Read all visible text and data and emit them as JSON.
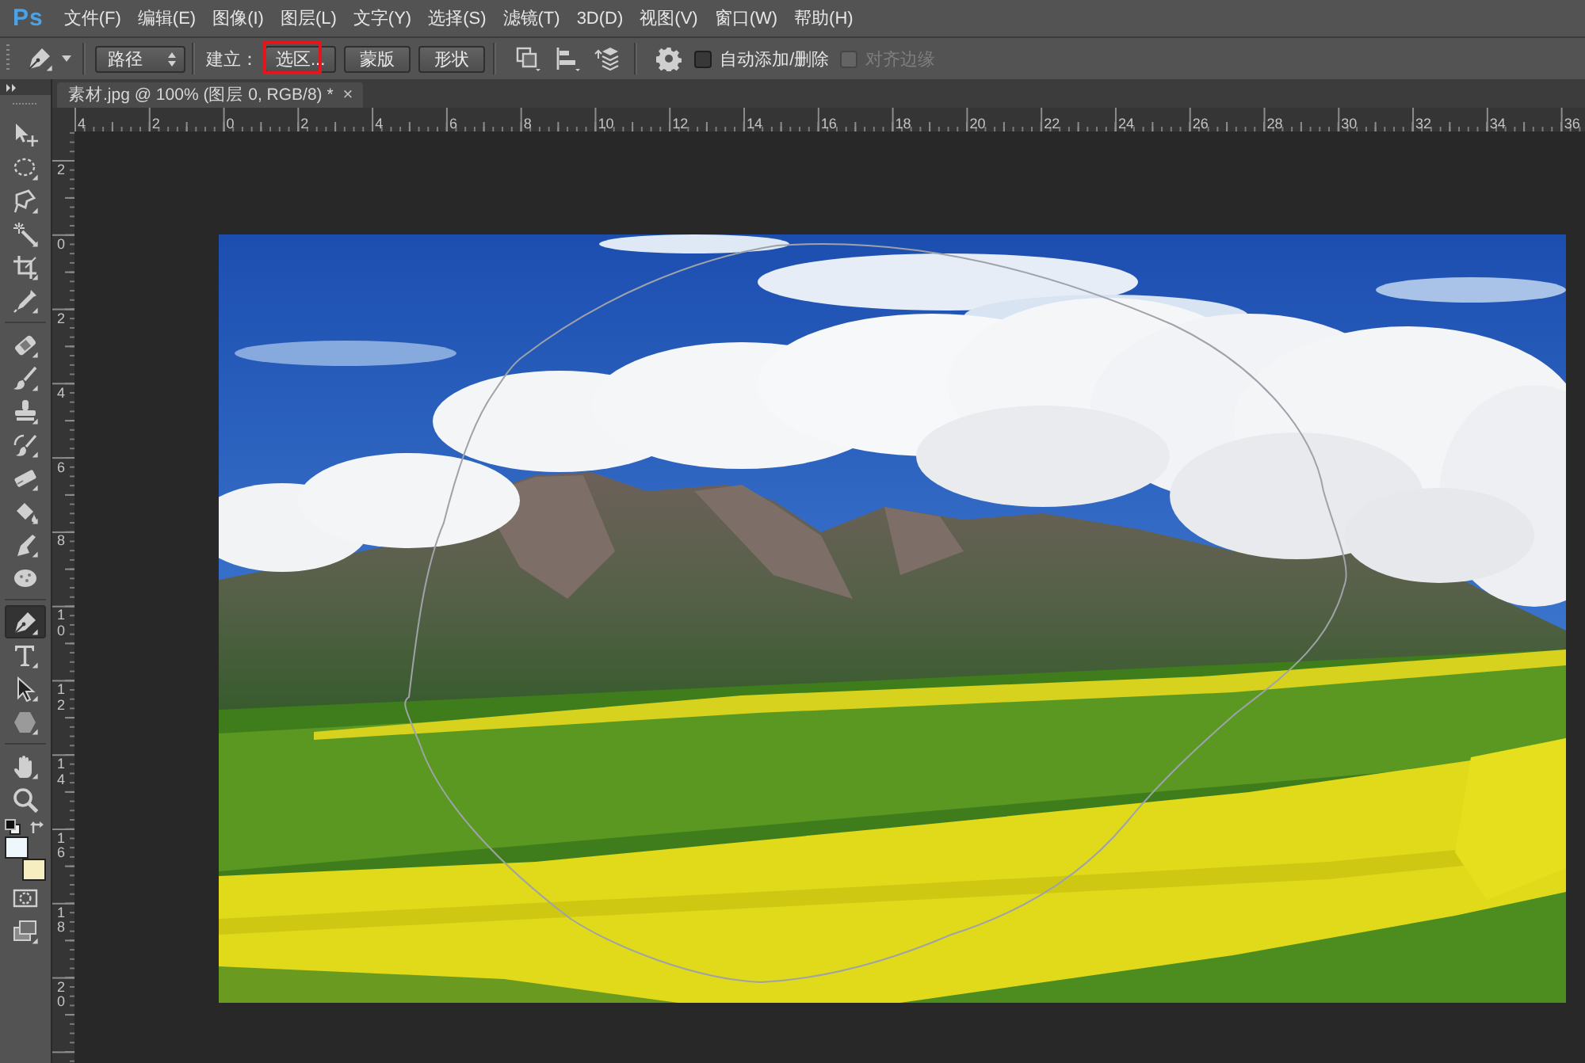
{
  "app": {
    "logo": "Ps"
  },
  "menu": [
    "文件(F)",
    "编辑(E)",
    "图像(I)",
    "图层(L)",
    "文字(Y)",
    "选择(S)",
    "滤镜(T)",
    "3D(D)",
    "视图(V)",
    "窗口(W)",
    "帮助(H)"
  ],
  "options_bar": {
    "mode_dropdown": "路径",
    "make_label": "建立：",
    "buttons": [
      {
        "label": "选区...",
        "highlighted": true
      },
      {
        "label": "蒙版",
        "highlighted": false
      },
      {
        "label": "形状",
        "highlighted": false
      }
    ],
    "checkboxes": [
      {
        "label": "自动添加/删除",
        "checked": false,
        "disabled": false
      },
      {
        "label": "对齐边缘",
        "checked": false,
        "disabled": true
      }
    ]
  },
  "toolbar": {
    "tool_groups": [
      {
        "tools": [
          {
            "kind": "move",
            "selected": false
          },
          {
            "kind": "marquee",
            "selected": false
          },
          {
            "kind": "lasso",
            "selected": false
          },
          {
            "kind": "wand",
            "selected": false
          },
          {
            "kind": "crop",
            "selected": false
          },
          {
            "kind": "eyedropper",
            "selected": false
          }
        ]
      },
      {
        "tools": [
          {
            "kind": "healing",
            "selected": false
          },
          {
            "kind": "brush",
            "selected": false
          },
          {
            "kind": "stamp",
            "selected": false
          },
          {
            "kind": "history",
            "selected": false
          },
          {
            "kind": "eraser",
            "selected": false
          },
          {
            "kind": "bucket",
            "selected": false
          },
          {
            "kind": "smudge",
            "selected": false
          },
          {
            "kind": "sponge",
            "selected": false
          }
        ]
      },
      {
        "tools": [
          {
            "kind": "pen",
            "selected": true
          },
          {
            "kind": "type",
            "selected": false
          },
          {
            "kind": "select",
            "selected": false
          },
          {
            "kind": "shape",
            "selected": false
          }
        ]
      },
      {
        "tools": [
          {
            "kind": "hand",
            "selected": false
          },
          {
            "kind": "zoom",
            "selected": false
          }
        ]
      }
    ],
    "swatches": [
      {
        "kind": "foreground",
        "color": "#eef8fc"
      },
      {
        "kind": "background",
        "color": "#f6eec0"
      }
    ],
    "mode_tools": [
      {
        "kind": "quickmask"
      },
      {
        "kind": "screenmode"
      }
    ]
  },
  "document": {
    "tab": {
      "title": "素材.jpg @ 100% (图层 0, RGB/8) *",
      "close": "×"
    },
    "horizontal_ruler": [
      "4",
      "2",
      "0",
      "2",
      "4",
      "6",
      "8",
      "10",
      "12",
      "14",
      "16",
      "18",
      "20",
      "22",
      "24",
      "26",
      "28",
      "30",
      "32",
      "34",
      "36"
    ],
    "vertical_ruler": [
      "2",
      "0",
      "2",
      "4",
      "6",
      "8",
      "10",
      "12",
      "14",
      "16",
      "18",
      "20"
    ]
  }
}
